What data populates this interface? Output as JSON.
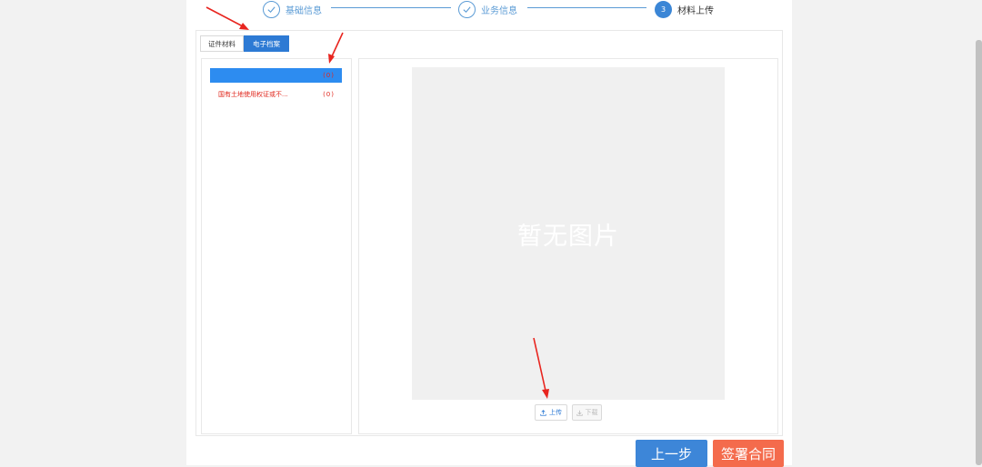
{
  "steps": [
    {
      "label": "基础信息",
      "state": "done"
    },
    {
      "label": "业务信息",
      "state": "done"
    },
    {
      "label": "材料上传",
      "number": "3",
      "state": "active"
    }
  ],
  "tabs": {
    "certificate": "证件材料",
    "electronic_archive": "电子档案"
  },
  "material_list": [
    {
      "label": "",
      "count": "(0)",
      "selected": true
    },
    {
      "label": "国有土地使用权证或不...",
      "count": "(0)",
      "selected": false
    }
  ],
  "preview": {
    "empty_text": "暂无图片"
  },
  "buttons": {
    "upload": "上传",
    "download": "下载",
    "prev_step": "上一步",
    "sign_contract": "签署合同"
  },
  "colors": {
    "accent": "#2d7ad4",
    "danger_text": "#e0281e",
    "sign_button": "#f46b4c",
    "annotation_arrow": "#e8251f"
  },
  "icons": {
    "step_done": "check-icon",
    "upload": "upload-icon",
    "download": "download-icon"
  }
}
